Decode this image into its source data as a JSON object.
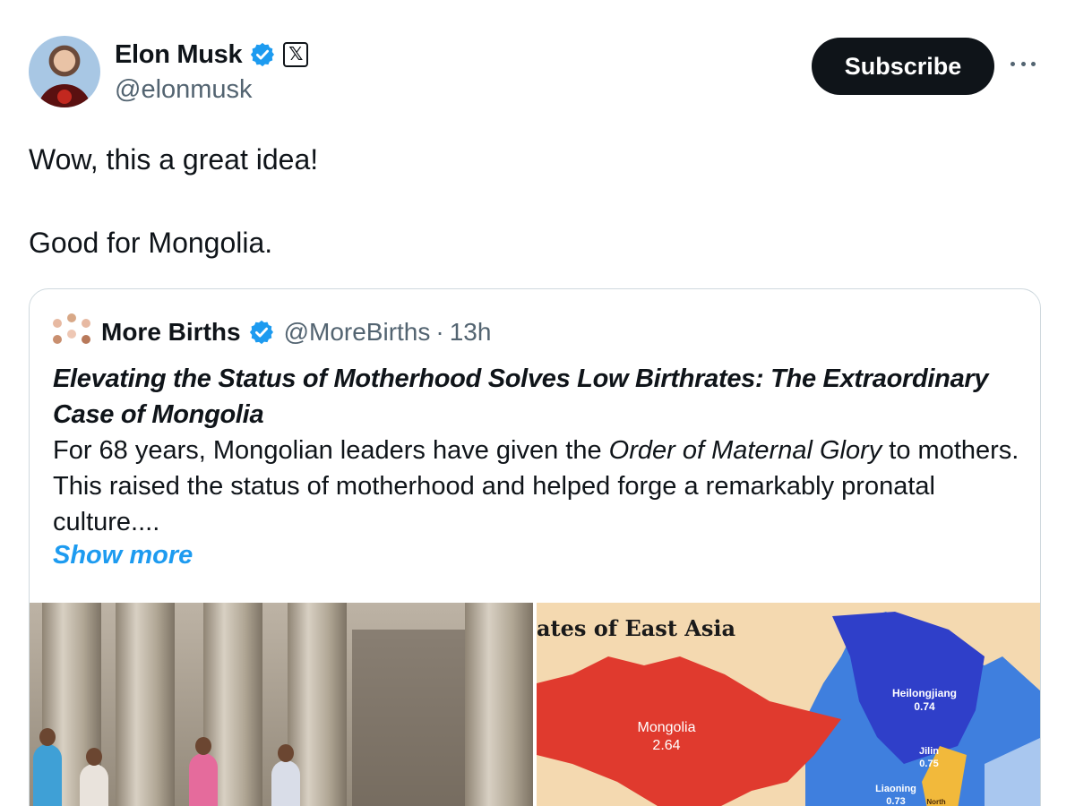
{
  "post": {
    "author": {
      "display_name": "Elon Musk",
      "handle": "@elonmusk"
    },
    "subscribe_label": "Subscribe",
    "text": [
      "Wow, this a great idea!",
      "Good for Mongolia."
    ]
  },
  "quote": {
    "author": {
      "display_name": "More Births",
      "handle": "@MoreBirths"
    },
    "separator": "·",
    "time": "13h",
    "title": "Elevating the Status of Motherhood Solves Low Birthrates: The Extraordinary Case of Mongolia",
    "body": {
      "part1": "For 68 years, Mongolian leaders have given the ",
      "emphasis": "Order of Maternal Glory",
      "part2": " to mothers. This raised the status of motherhood and helped forge a remarkably pronatal culture...."
    },
    "show_more_label": "Show more",
    "map": {
      "title_fragment": "ates of East Asia",
      "regions": [
        {
          "name": "Mongolia",
          "value": "2.64"
        },
        {
          "name": "Heilongjiang",
          "value": "0.74"
        },
        {
          "name": "Jilin",
          "value": "0.75"
        },
        {
          "name": "Liaoning",
          "value": "0.73"
        },
        {
          "name": "North"
        }
      ]
    }
  },
  "colors": {
    "text": "#0f1419",
    "secondary": "#536471",
    "link": "#1d9bf0",
    "verified": "#1d9bf0",
    "button": "#0f1419",
    "border": "#cfd9de",
    "map_mongolia": "#e03a2e",
    "map_china": "#3f7fde",
    "map_northeast": "#2f3fc9",
    "map_background": "#f4d9b0"
  },
  "icons": {
    "verified": "verified-badge-icon",
    "affiliate": "x-logo-icon",
    "more": "more-options-icon"
  }
}
